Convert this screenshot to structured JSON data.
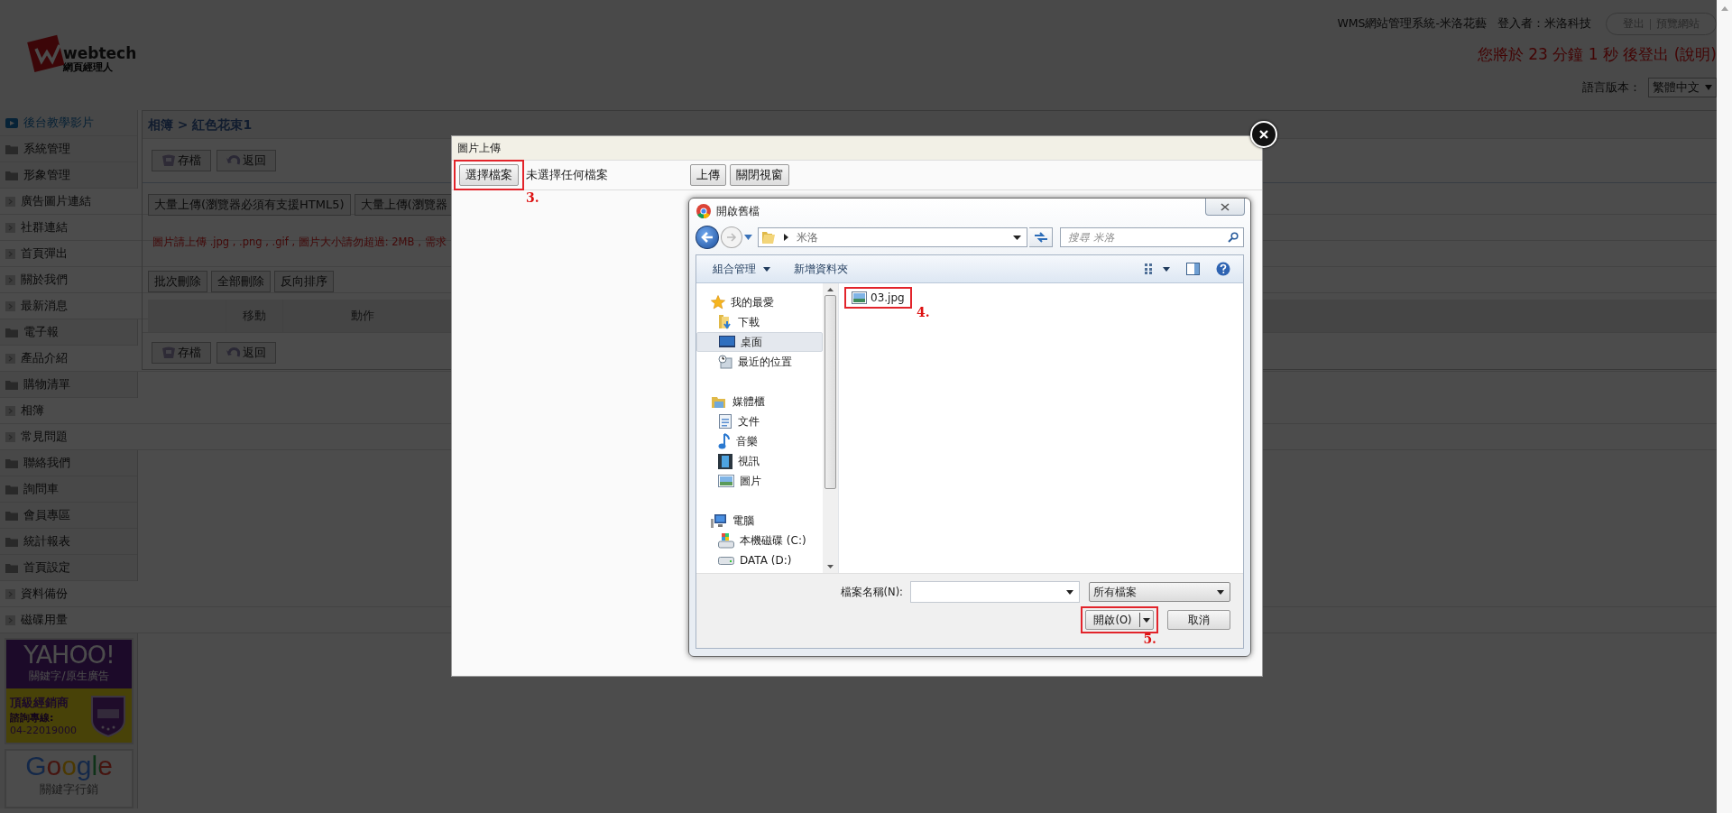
{
  "header": {
    "logo_text": "webtech",
    "logo_subtitle": "網頁經理人",
    "system_title": "WMS網站管理系統-米洛花藝",
    "login_label": "登入者：米洛科技",
    "user_links": [
      "登出",
      "預覽網站"
    ],
    "logout_notice": "您將於 23 分鐘 1 秒 後登出 (說明)",
    "language_label": "語言版本：",
    "language_value": "繁體中文"
  },
  "sidebar": {
    "items": [
      {
        "label": "後台教學影片",
        "kind": "video"
      },
      {
        "label": "系統管理",
        "kind": "folder"
      },
      {
        "label": "形象管理",
        "kind": "folder"
      },
      {
        "label": "廣告圖片連結",
        "kind": "page"
      },
      {
        "label": "社群連結",
        "kind": "page"
      },
      {
        "label": "首頁彈出",
        "kind": "page"
      },
      {
        "label": "關於我們",
        "kind": "page"
      },
      {
        "label": "最新消息",
        "kind": "page"
      },
      {
        "label": "電子報",
        "kind": "folder"
      },
      {
        "label": "產品介紹",
        "kind": "page"
      },
      {
        "label": "購物清單",
        "kind": "folder"
      },
      {
        "label": "相簿",
        "kind": "page"
      },
      {
        "label": "常見問題",
        "kind": "page"
      },
      {
        "label": "聯絡我們",
        "kind": "folder"
      },
      {
        "label": "詢問車",
        "kind": "folder"
      },
      {
        "label": "會員專區",
        "kind": "folder"
      },
      {
        "label": "統計報表",
        "kind": "folder"
      },
      {
        "label": "首頁設定",
        "kind": "folder"
      },
      {
        "label": "資料備份",
        "kind": "page"
      },
      {
        "label": "磁碟用量",
        "kind": "page"
      }
    ],
    "ads": [
      {
        "kind": "yahoo",
        "brand": "YAHOO!",
        "tagline": "關鍵字/原生廣告",
        "badge_title": "頂級經銷商",
        "hotline_label": "諮詢專線:",
        "hotline": "04-22019000"
      },
      {
        "kind": "google",
        "brand": "Google",
        "tagline": "關鍵字行銷"
      }
    ]
  },
  "main": {
    "breadcrumb": "相簿 > 紅色花束1",
    "toolbar": [
      {
        "label": "存檔",
        "kind": "save"
      },
      {
        "label": "返回",
        "kind": "back"
      }
    ],
    "bulk_upload_buttons": [
      "大量上傳(瀏覽器必須有支援HTML5)",
      "大量上傳(瀏覽器"
    ],
    "notice": "圖片請上傳 .jpg , .png , .gif , 圖片大小請勿超過: 2MB，需求",
    "list_buttons": [
      "批次刪除",
      "全部刪除",
      "反向排序"
    ],
    "table": {
      "columns": [
        "移動",
        "動作"
      ]
    },
    "bottom_toolbar": [
      {
        "label": "存檔",
        "kind": "save"
      },
      {
        "label": "返回",
        "kind": "back"
      }
    ]
  },
  "upload_modal": {
    "title": "圖片上傳",
    "choose_button": "選擇檔案",
    "file_status": "未選擇任何檔案",
    "buttons": [
      "上傳",
      "關閉視窗"
    ],
    "step": "3."
  },
  "file_dialog": {
    "title": "開啟舊檔",
    "path": "米洛",
    "search": {
      "placeholder": "搜尋 米洛"
    },
    "toolbar": [
      "組合管理",
      "新增資料夾"
    ],
    "nav": [
      {
        "label": "我的最愛",
        "kind": "favorites",
        "selected": false,
        "children": [
          {
            "label": "下載",
            "kind": "downloads",
            "selected": false
          },
          {
            "label": "桌面",
            "kind": "desktop",
            "selected": true
          },
          {
            "label": "最近的位置",
            "kind": "recent",
            "selected": false
          }
        ]
      },
      {
        "label": "媒體櫃",
        "kind": "library",
        "selected": false,
        "children": [
          {
            "label": "文件",
            "kind": "documents",
            "selected": false
          },
          {
            "label": "音樂",
            "kind": "music",
            "selected": false
          },
          {
            "label": "視訊",
            "kind": "video",
            "selected": false
          },
          {
            "label": "圖片",
            "kind": "pictures",
            "selected": false
          }
        ]
      },
      {
        "label": "電腦",
        "kind": "computer",
        "selected": false,
        "children": [
          {
            "label": "本機磁碟 (C:)",
            "kind": "system-drive",
            "selected": false
          },
          {
            "label": "DATA (D:)",
            "kind": "drive",
            "selected": false
          }
        ]
      }
    ],
    "files": [
      {
        "name": "03.jpg",
        "step": "4."
      }
    ],
    "file_name_label": "檔案名稱(N):",
    "file_type": "所有檔案",
    "open_button": "開啟(O)",
    "open_step": "5.",
    "cancel_button": "取消"
  }
}
